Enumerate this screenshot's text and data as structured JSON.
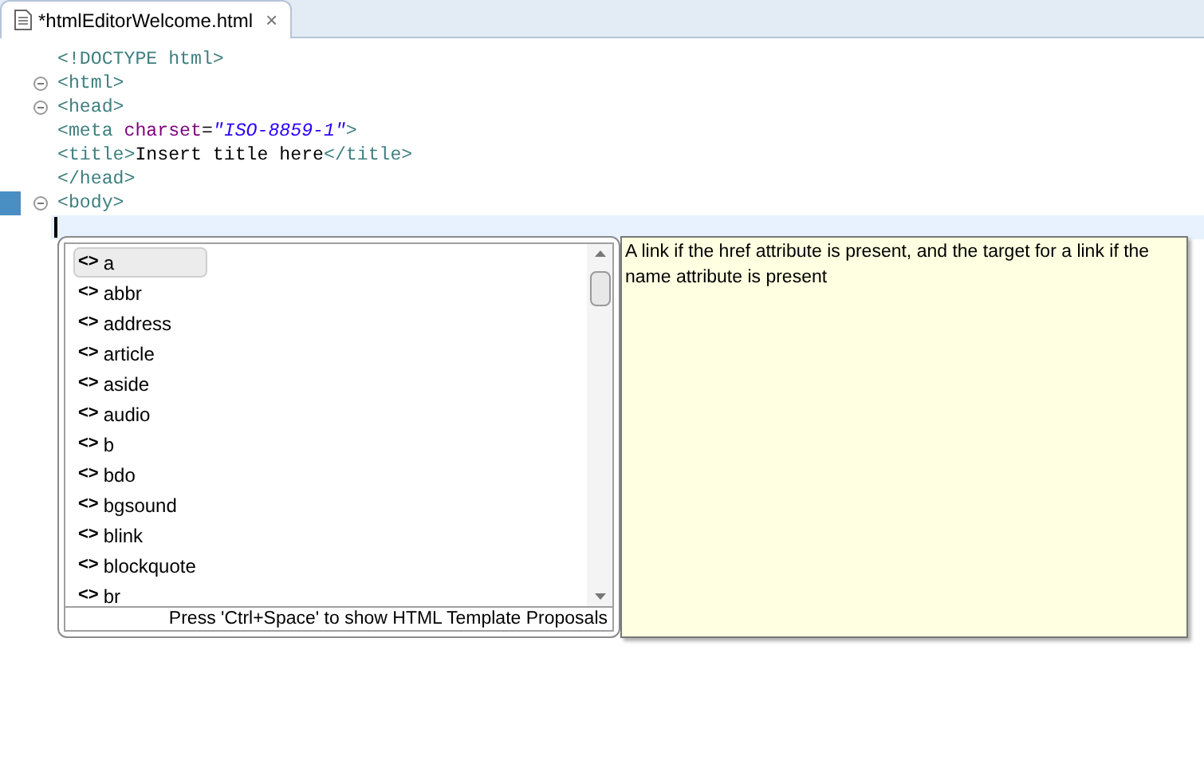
{
  "editor_tab": {
    "title": "*htmlEditorWelcome.html",
    "close": "×",
    "selected": true
  },
  "code_lines": [
    {
      "fold": false,
      "marked": false,
      "tokens": [
        {
          "kind": "tag",
          "text": "<!DOCTYPE "
        },
        {
          "kind": "keyword",
          "text": "html"
        },
        {
          "kind": "tag",
          "text": ">"
        }
      ]
    },
    {
      "fold": true,
      "marked": false,
      "tokens": [
        {
          "kind": "tag",
          "text": "<html>"
        }
      ]
    },
    {
      "fold": true,
      "marked": false,
      "tokens": [
        {
          "kind": "tag",
          "text": "<head>"
        }
      ]
    },
    {
      "fold": false,
      "marked": false,
      "tokens": [
        {
          "kind": "tag",
          "text": "<meta "
        },
        {
          "kind": "attr",
          "text": "charset"
        },
        {
          "kind": "text",
          "text": "="
        },
        {
          "kind": "value",
          "text": "\"ISO-8859-1\""
        },
        {
          "kind": "tag",
          "text": ">"
        }
      ]
    },
    {
      "fold": false,
      "marked": false,
      "tokens": [
        {
          "kind": "tag",
          "text": "<title>"
        },
        {
          "kind": "text",
          "text": "Insert title here"
        },
        {
          "kind": "tag",
          "text": "</title>"
        }
      ]
    },
    {
      "fold": false,
      "marked": false,
      "tokens": [
        {
          "kind": "tag",
          "text": "</head>"
        }
      ]
    },
    {
      "fold": true,
      "marked": true,
      "tokens": [
        {
          "kind": "tag",
          "text": "<body>"
        }
      ]
    }
  ],
  "proposals": {
    "items": [
      {
        "icon": "<>",
        "label": "a",
        "selected": true
      },
      {
        "icon": "<>",
        "label": "abbr",
        "selected": false
      },
      {
        "icon": "<>",
        "label": "address",
        "selected": false
      },
      {
        "icon": "<>",
        "label": "article",
        "selected": false
      },
      {
        "icon": "<>",
        "label": "aside",
        "selected": false
      },
      {
        "icon": "<>",
        "label": "audio",
        "selected": false
      },
      {
        "icon": "<>",
        "label": "b",
        "selected": false
      },
      {
        "icon": "<>",
        "label": "bdo",
        "selected": false
      },
      {
        "icon": "<>",
        "label": "bgsound",
        "selected": false
      },
      {
        "icon": "<>",
        "label": "blink",
        "selected": false
      },
      {
        "icon": "<>",
        "label": "blockquote",
        "selected": false
      },
      {
        "icon": "<>",
        "label": "br",
        "selected": false
      }
    ],
    "status": "Press 'Ctrl+Space' to show HTML Template Proposals"
  },
  "description": "A link if the href attribute is present, and the target for a link if the name attribute is present"
}
